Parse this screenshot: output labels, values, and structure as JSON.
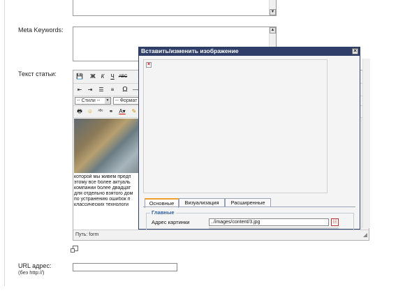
{
  "form": {
    "meta_keywords_label": "Meta Keywords:",
    "article_text_label": "Текст статьи:",
    "url_label": "URL адрес:",
    "url_hint": "(без http://)"
  },
  "editor": {
    "styles_select": "-- Стили --",
    "format_select": "-- Формат",
    "body_lines": [
      "которой мы живем предп",
      "этому все более актуаль",
      "компании более двадцат",
      "для отдельно взятого дом",
      "по устранению ошибок п",
      "классических технологи"
    ],
    "path_label": "Путь: form"
  },
  "dialog": {
    "title": "Вставить/изменить изображение",
    "tabs": [
      "Основные",
      "Визуализация",
      "Расширенные"
    ],
    "section_legend": "Главные",
    "image_url_label": "Адрес картинки",
    "image_url_value": "../images/content/3.jpg"
  }
}
